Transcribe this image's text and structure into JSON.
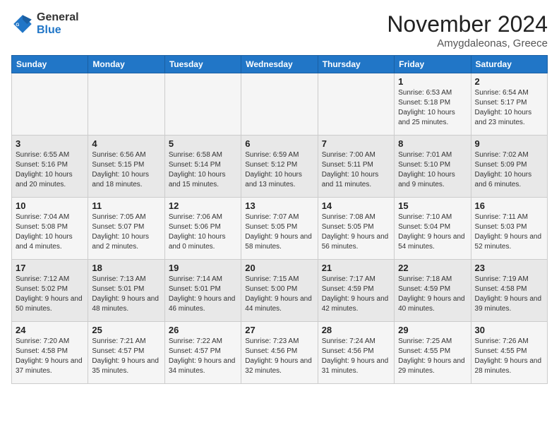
{
  "header": {
    "logo_general": "General",
    "logo_blue": "Blue",
    "month_title": "November 2024",
    "subtitle": "Amygdaleonas, Greece"
  },
  "weekdays": [
    "Sunday",
    "Monday",
    "Tuesday",
    "Wednesday",
    "Thursday",
    "Friday",
    "Saturday"
  ],
  "weeks": [
    [
      {
        "day": "",
        "content": ""
      },
      {
        "day": "",
        "content": ""
      },
      {
        "day": "",
        "content": ""
      },
      {
        "day": "",
        "content": ""
      },
      {
        "day": "",
        "content": ""
      },
      {
        "day": "1",
        "content": "Sunrise: 6:53 AM\nSunset: 5:18 PM\nDaylight: 10 hours and 25 minutes."
      },
      {
        "day": "2",
        "content": "Sunrise: 6:54 AM\nSunset: 5:17 PM\nDaylight: 10 hours and 23 minutes."
      }
    ],
    [
      {
        "day": "3",
        "content": "Sunrise: 6:55 AM\nSunset: 5:16 PM\nDaylight: 10 hours and 20 minutes."
      },
      {
        "day": "4",
        "content": "Sunrise: 6:56 AM\nSunset: 5:15 PM\nDaylight: 10 hours and 18 minutes."
      },
      {
        "day": "5",
        "content": "Sunrise: 6:58 AM\nSunset: 5:14 PM\nDaylight: 10 hours and 15 minutes."
      },
      {
        "day": "6",
        "content": "Sunrise: 6:59 AM\nSunset: 5:12 PM\nDaylight: 10 hours and 13 minutes."
      },
      {
        "day": "7",
        "content": "Sunrise: 7:00 AM\nSunset: 5:11 PM\nDaylight: 10 hours and 11 minutes."
      },
      {
        "day": "8",
        "content": "Sunrise: 7:01 AM\nSunset: 5:10 PM\nDaylight: 10 hours and 9 minutes."
      },
      {
        "day": "9",
        "content": "Sunrise: 7:02 AM\nSunset: 5:09 PM\nDaylight: 10 hours and 6 minutes."
      }
    ],
    [
      {
        "day": "10",
        "content": "Sunrise: 7:04 AM\nSunset: 5:08 PM\nDaylight: 10 hours and 4 minutes."
      },
      {
        "day": "11",
        "content": "Sunrise: 7:05 AM\nSunset: 5:07 PM\nDaylight: 10 hours and 2 minutes."
      },
      {
        "day": "12",
        "content": "Sunrise: 7:06 AM\nSunset: 5:06 PM\nDaylight: 10 hours and 0 minutes."
      },
      {
        "day": "13",
        "content": "Sunrise: 7:07 AM\nSunset: 5:05 PM\nDaylight: 9 hours and 58 minutes."
      },
      {
        "day": "14",
        "content": "Sunrise: 7:08 AM\nSunset: 5:05 PM\nDaylight: 9 hours and 56 minutes."
      },
      {
        "day": "15",
        "content": "Sunrise: 7:10 AM\nSunset: 5:04 PM\nDaylight: 9 hours and 54 minutes."
      },
      {
        "day": "16",
        "content": "Sunrise: 7:11 AM\nSunset: 5:03 PM\nDaylight: 9 hours and 52 minutes."
      }
    ],
    [
      {
        "day": "17",
        "content": "Sunrise: 7:12 AM\nSunset: 5:02 PM\nDaylight: 9 hours and 50 minutes."
      },
      {
        "day": "18",
        "content": "Sunrise: 7:13 AM\nSunset: 5:01 PM\nDaylight: 9 hours and 48 minutes."
      },
      {
        "day": "19",
        "content": "Sunrise: 7:14 AM\nSunset: 5:01 PM\nDaylight: 9 hours and 46 minutes."
      },
      {
        "day": "20",
        "content": "Sunrise: 7:15 AM\nSunset: 5:00 PM\nDaylight: 9 hours and 44 minutes."
      },
      {
        "day": "21",
        "content": "Sunrise: 7:17 AM\nSunset: 4:59 PM\nDaylight: 9 hours and 42 minutes."
      },
      {
        "day": "22",
        "content": "Sunrise: 7:18 AM\nSunset: 4:59 PM\nDaylight: 9 hours and 40 minutes."
      },
      {
        "day": "23",
        "content": "Sunrise: 7:19 AM\nSunset: 4:58 PM\nDaylight: 9 hours and 39 minutes."
      }
    ],
    [
      {
        "day": "24",
        "content": "Sunrise: 7:20 AM\nSunset: 4:58 PM\nDaylight: 9 hours and 37 minutes."
      },
      {
        "day": "25",
        "content": "Sunrise: 7:21 AM\nSunset: 4:57 PM\nDaylight: 9 hours and 35 minutes."
      },
      {
        "day": "26",
        "content": "Sunrise: 7:22 AM\nSunset: 4:57 PM\nDaylight: 9 hours and 34 minutes."
      },
      {
        "day": "27",
        "content": "Sunrise: 7:23 AM\nSunset: 4:56 PM\nDaylight: 9 hours and 32 minutes."
      },
      {
        "day": "28",
        "content": "Sunrise: 7:24 AM\nSunset: 4:56 PM\nDaylight: 9 hours and 31 minutes."
      },
      {
        "day": "29",
        "content": "Sunrise: 7:25 AM\nSunset: 4:55 PM\nDaylight: 9 hours and 29 minutes."
      },
      {
        "day": "30",
        "content": "Sunrise: 7:26 AM\nSunset: 4:55 PM\nDaylight: 9 hours and 28 minutes."
      }
    ]
  ]
}
